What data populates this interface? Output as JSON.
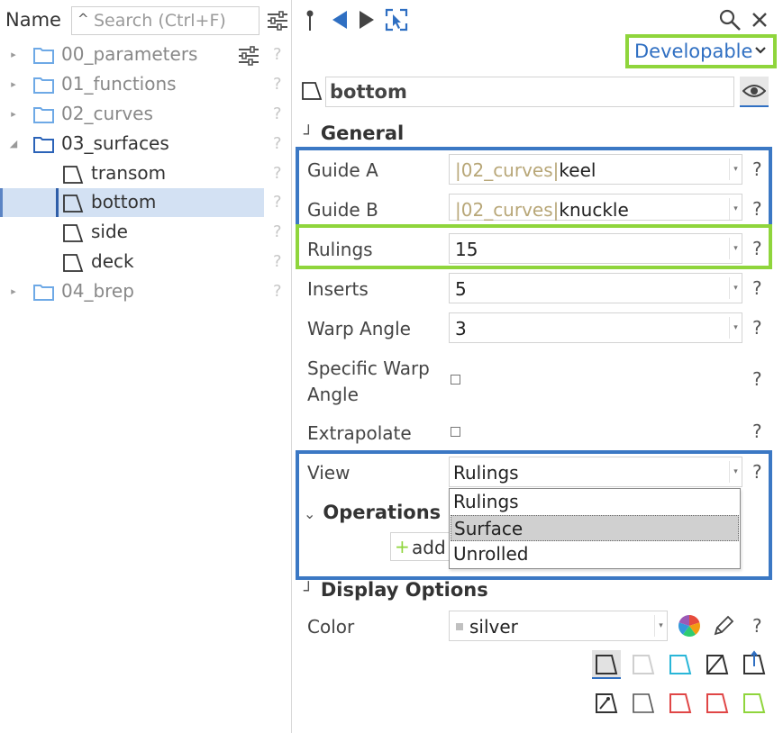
{
  "tree": {
    "header_label": "Name",
    "search_placeholder": "Search (Ctrl+F)",
    "items": [
      {
        "label": "00_parameters",
        "help": "?"
      },
      {
        "label": "01_functions",
        "help": "?"
      },
      {
        "label": "02_curves",
        "help": "?"
      },
      {
        "label": "03_surfaces",
        "help": "?"
      },
      {
        "label": "transom",
        "help": "?"
      },
      {
        "label": "bottom",
        "help": "?"
      },
      {
        "label": "side",
        "help": "?"
      },
      {
        "label": "deck",
        "help": "?"
      },
      {
        "label": "04_brep",
        "help": "?"
      }
    ]
  },
  "toolbar": {
    "surface_type": "Developable"
  },
  "object": {
    "name": "bottom"
  },
  "general": {
    "title": "General",
    "guide_a": {
      "label": "Guide A",
      "prefix": "|02_curves|",
      "value": "keel"
    },
    "guide_b": {
      "label": "Guide B",
      "prefix": "|02_curves|",
      "value": "knuckle"
    },
    "rulings": {
      "label": "Rulings",
      "value": "15"
    },
    "inserts": {
      "label": "Inserts",
      "value": "5"
    },
    "warp_angle": {
      "label": "Warp Angle",
      "value": "3"
    },
    "specific_warp_angle": {
      "label_line1": "Specific Warp",
      "label_line2": "Angle"
    },
    "extrapolate": {
      "label": "Extrapolate"
    },
    "view": {
      "label": "View",
      "value": "Rulings",
      "options": [
        "Rulings",
        "Surface",
        "Unrolled"
      ]
    },
    "help": "?"
  },
  "operations": {
    "title": "Operations",
    "add_label": "add"
  },
  "display": {
    "title": "Display Options",
    "color_label": "Color",
    "color_value": "silver"
  },
  "colors": {
    "highlight_green": "#8fd53c",
    "highlight_blue": "#3b78c4",
    "folder_blue": "#4a8fd8",
    "selection": "#d3e1f3"
  }
}
